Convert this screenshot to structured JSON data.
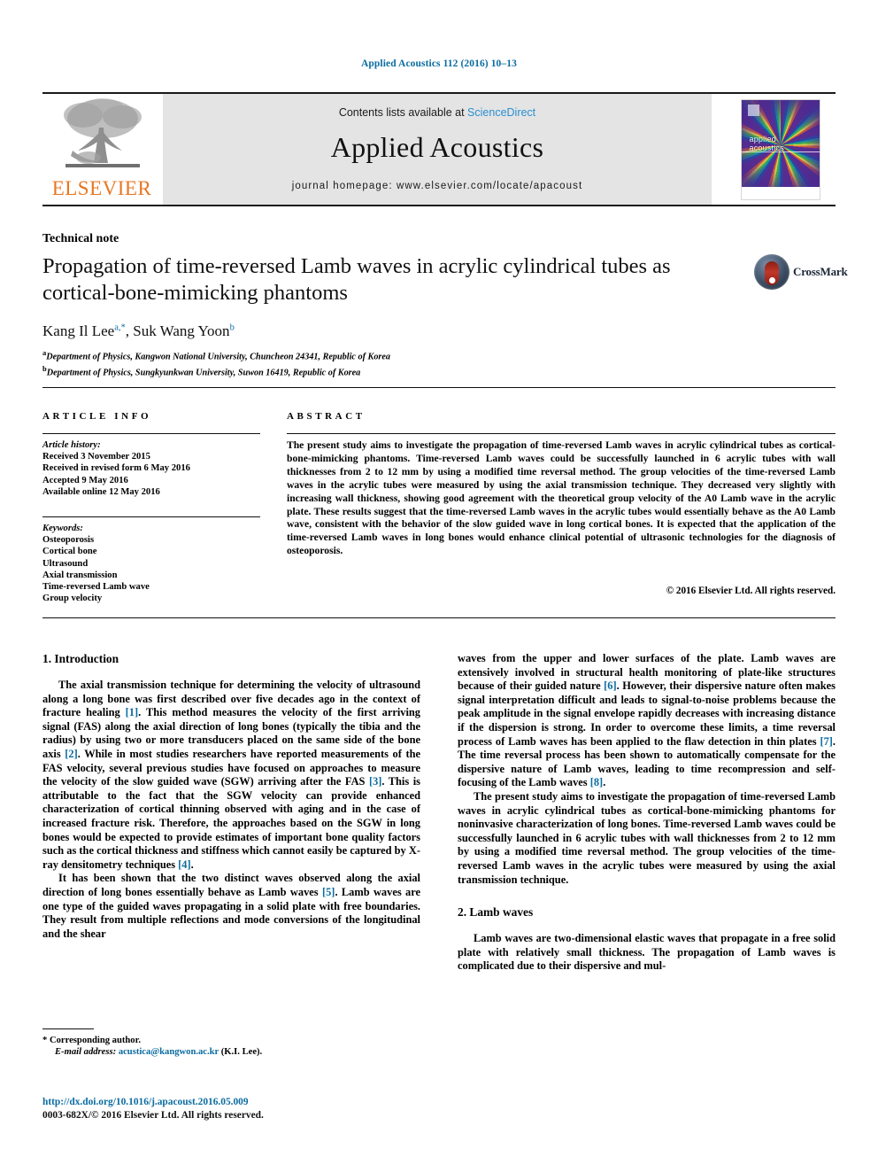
{
  "running_head": "Applied Acoustics 112 (2016) 10–13",
  "masthead": {
    "publisher_name": "ELSEVIER",
    "publisher_logo_icon": "elsevier-tree-icon",
    "contents_prefix": "Contents lists available at ",
    "contents_link": "ScienceDirect",
    "journal_title": "Applied Acoustics",
    "homepage_line": "journal homepage: www.elsevier.com/locate/apacoust",
    "cover": {
      "line1": "applied",
      "line2": "acoustics"
    }
  },
  "article": {
    "type_label": "Technical note",
    "title": "Propagation of time-reversed Lamb waves in acrylic cylindrical tubes as cortical-bone-mimicking phantoms",
    "crossmark_label": "CrossMark",
    "authors_html": "Kang Il Lee<sup>a,*</sup>, Suk Wang Yoon<sup>b</sup>",
    "affiliations": [
      {
        "marker": "a",
        "text": "Department of Physics, Kangwon National University, Chuncheon 24341, Republic of Korea"
      },
      {
        "marker": "b",
        "text": "Department of Physics, Sungkyunkwan University, Suwon 16419, Republic of Korea"
      }
    ]
  },
  "info_column": {
    "heading": "ARTICLE INFO",
    "history_title": "Article history:",
    "history": [
      "Received 3 November 2015",
      "Received in revised form 6 May 2016",
      "Accepted 9 May 2016",
      "Available online 12 May 2016"
    ],
    "keywords_title": "Keywords:",
    "keywords": [
      "Osteoporosis",
      "Cortical bone",
      "Ultrasound",
      "Axial transmission",
      "Time-reversed Lamb wave",
      "Group velocity"
    ]
  },
  "abstract": {
    "heading": "ABSTRACT",
    "text": "The present study aims to investigate the propagation of time-reversed Lamb waves in acrylic cylindrical tubes as cortical-bone-mimicking phantoms. Time-reversed Lamb waves could be successfully launched in 6 acrylic tubes with wall thicknesses from 2 to 12 mm by using a modified time reversal method. The group velocities of the time-reversed Lamb waves in the acrylic tubes were measured by using the axial transmission technique. They decreased very slightly with increasing wall thickness, showing good agreement with the theoretical group velocity of the A0 Lamb wave in the acrylic plate. These results suggest that the time-reversed Lamb waves in the acrylic tubes would essentially behave as the A0 Lamb wave, consistent with the behavior of the slow guided wave in long cortical bones. It is expected that the application of the time-reversed Lamb waves in long bones would enhance clinical potential of ultrasonic technologies for the diagnosis of osteoporosis.",
    "copyright": "© 2016 Elsevier Ltd. All rights reserved."
  },
  "body": {
    "left": {
      "section1_heading": "1. Introduction",
      "para1_a": "The axial transmission technique for determining the velocity of ultrasound along a long bone was first described over five decades ago in the context of fracture healing ",
      "ref1": "[1]",
      "para1_b": ". This method measures the velocity of the first arriving signal (FAS) along the axial direction of long bones (typically the tibia and the radius) by using two or more transducers placed on the same side of the bone axis ",
      "ref2": "[2]",
      "para1_c": ". While in most studies researchers have reported measurements of the FAS velocity, several previous studies have focused on approaches to measure the velocity of the slow guided wave (SGW) arriving after the FAS ",
      "ref3": "[3]",
      "para1_d": ". This is attributable to the fact that the SGW velocity can provide enhanced characterization of cortical thinning observed with aging and in the case of increased fracture risk. Therefore, the approaches based on the SGW in long bones would be expected to provide estimates of important bone quality factors such as the cortical thickness and stiffness which cannot easily be captured by X-ray densitometry techniques ",
      "ref4": "[4]",
      "para1_e": ".",
      "para2_a": "It has been shown that the two distinct waves observed along the axial direction of long bones essentially behave as Lamb waves ",
      "ref5": "[5]",
      "para2_b": ". Lamb waves are one type of the guided waves propagating in a solid plate with free boundaries. They result from multiple reflections and mode conversions of the longitudinal and the shear"
    },
    "right": {
      "para1_a": "waves from the upper and lower surfaces of the plate. Lamb waves are extensively involved in structural health monitoring of plate-like structures because of their guided nature ",
      "ref6": "[6]",
      "para1_b": ". However, their dispersive nature often makes signal interpretation difficult and leads to signal-to-noise problems because the peak amplitude in the signal envelope rapidly decreases with increasing distance if the dispersion is strong. In order to overcome these limits, a time reversal process of Lamb waves has been applied to the flaw detection in thin plates ",
      "ref7": "[7]",
      "para1_c": ". The time reversal process has been shown to automatically compensate for the dispersive nature of Lamb waves, leading to time recompression and self-focusing of the Lamb waves ",
      "ref8": "[8]",
      "para1_d": ".",
      "para2": "The present study aims to investigate the propagation of time-reversed Lamb waves in acrylic cylindrical tubes as cortical-bone-mimicking phantoms for noninvasive characterization of long bones. Time-reversed Lamb waves could be successfully launched in 6 acrylic tubes with wall thicknesses from 2 to 12 mm by using a modified time reversal method. The group velocities of the time-reversed Lamb waves in the acrylic tubes were measured by using the axial transmission technique.",
      "section2_heading": "2. Lamb waves",
      "para3": "Lamb waves are two-dimensional elastic waves that propagate in a free solid plate with relatively small thickness. The propagation of Lamb waves is complicated due to their dispersive and mul-"
    }
  },
  "footer": {
    "corresponding_marker": "*",
    "corresponding_label": " Corresponding author.",
    "email_label": "E-mail address:",
    "email": "acustica@kangwon.ac.kr",
    "email_suffix": " (K.I. Lee).",
    "doi": "http://dx.doi.org/10.1016/j.apacoust.2016.05.009",
    "issn_line": "0003-682X/© 2016 Elsevier Ltd. All rights reserved."
  },
  "colors": {
    "link": "#0a6ba0",
    "sciencedirect": "#2a8fd0",
    "elsevier_orange": "#E87722",
    "panel_gray": "#e4e4e4"
  }
}
